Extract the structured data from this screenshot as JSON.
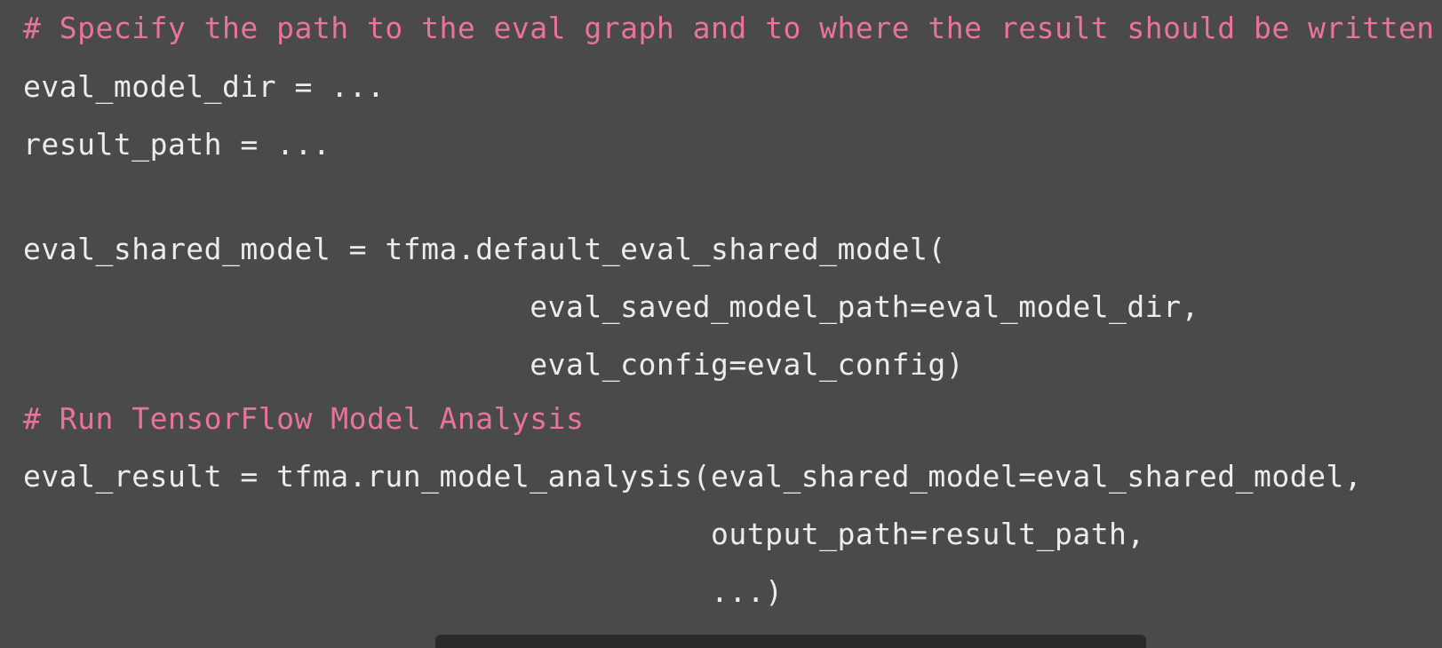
{
  "code": {
    "lines": [
      "# Specify the path to the eval graph and to where the result should be written",
      "eval_model_dir = ...",
      "result_path = ...",
      "",
      "eval_shared_model = tfma.default_eval_shared_model(",
      "                            eval_saved_model_path=eval_model_dir,",
      "                            eval_config=eval_config)",
      "# Run TensorFlow Model Analysis",
      "eval_result = tfma.run_model_analysis(eval_shared_model=eval_shared_model,",
      "                                      output_path=result_path,",
      "                                      ...)"
    ]
  },
  "colors": {
    "background": "#4a4a4a",
    "code_text": "#ececec",
    "comment": "#e8749a",
    "bottom_bar": "#2a2a2a"
  }
}
